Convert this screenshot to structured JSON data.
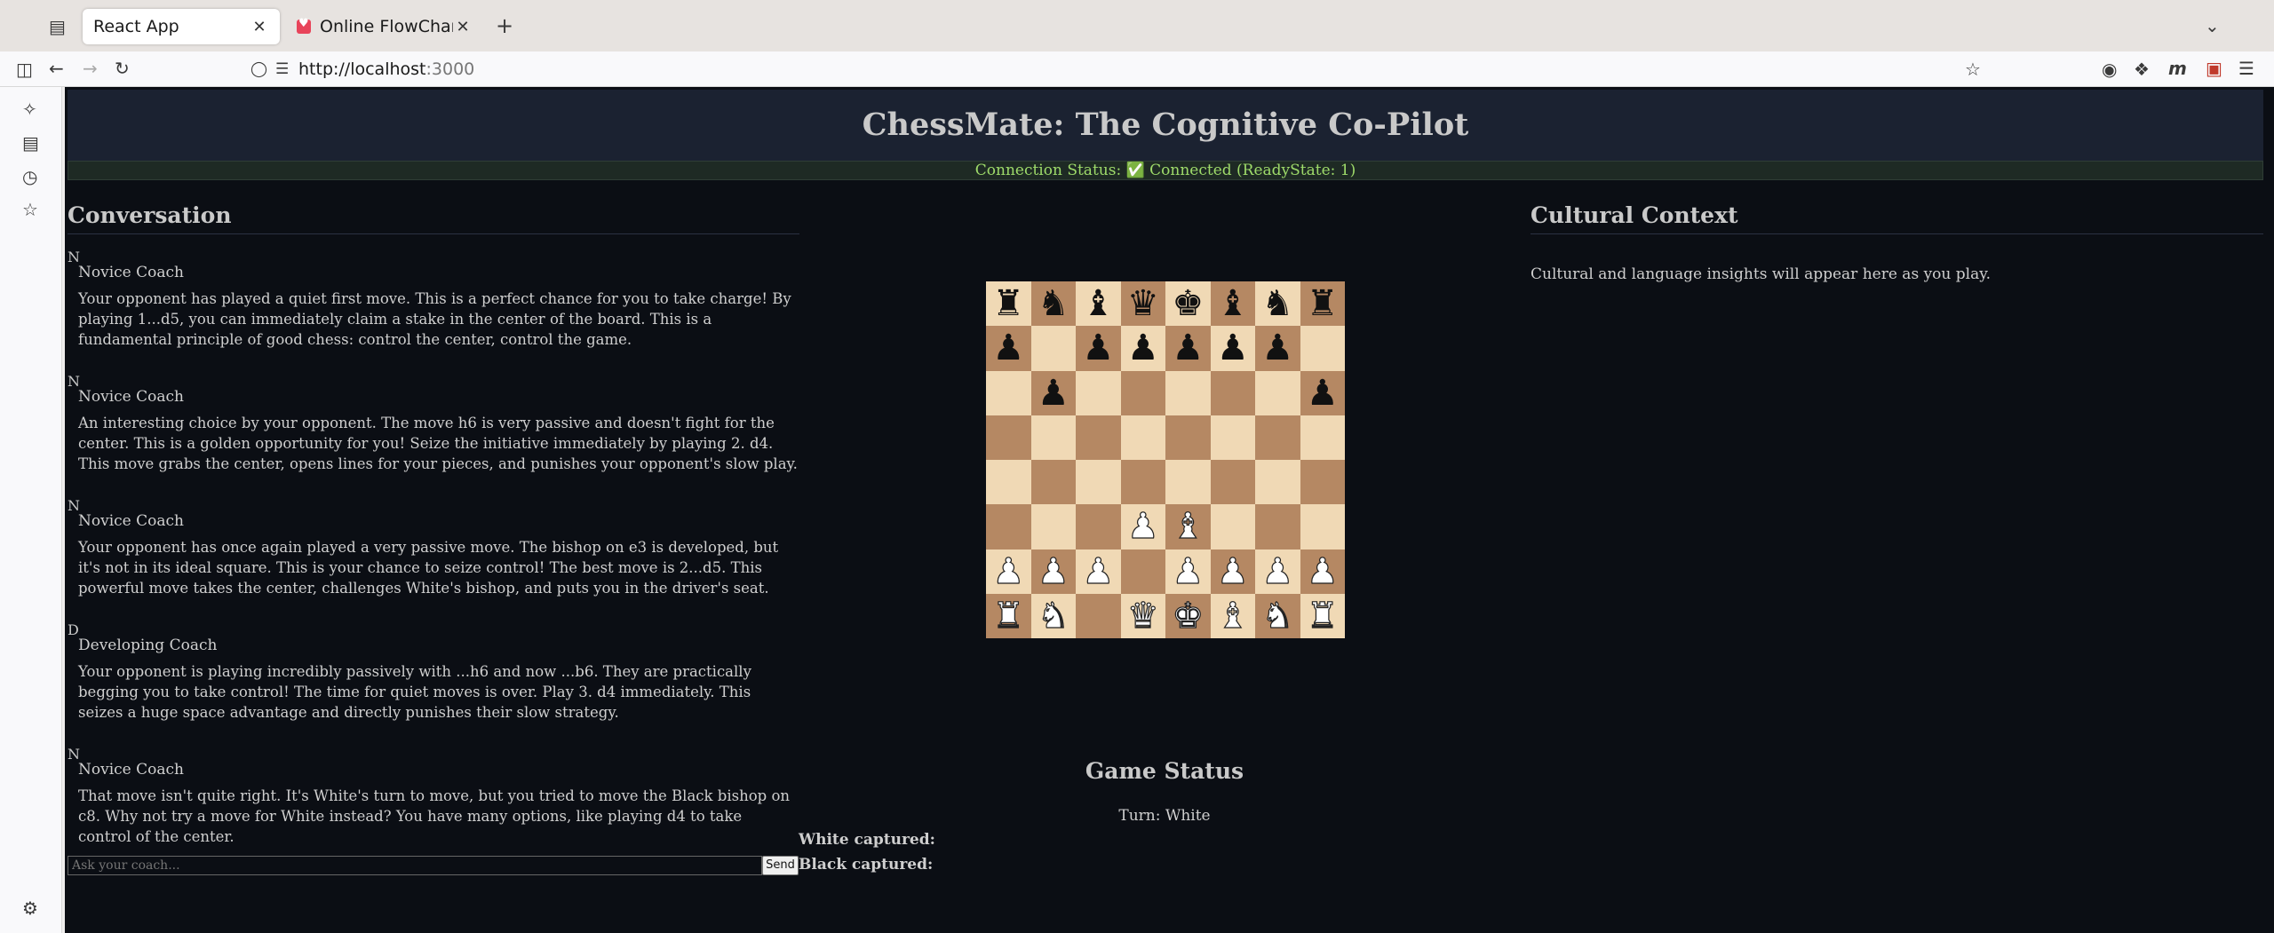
{
  "browser": {
    "tabs": [
      {
        "title": "React App",
        "active": true
      },
      {
        "title": "Online FlowChart & D",
        "active": false
      }
    ],
    "url_host": "http://localhost",
    "url_port": ":3000"
  },
  "app": {
    "title": "ChessMate: The Cognitive Co-Pilot",
    "connection_status": "Connection Status: ✅ Connected (ReadyState: 1)",
    "conversation": {
      "heading": "Conversation",
      "messages": [
        {
          "initial": "N",
          "speaker": "Novice Coach",
          "text": "Your opponent has played a quiet first move. This is a perfect chance for you to take charge! By playing 1...d5, you can immediately claim a stake in the center of the board. This is a fundamental principle of good chess: control the center, control the game."
        },
        {
          "initial": "N",
          "speaker": "Novice Coach",
          "text": "An interesting choice by your opponent. The move h6 is very passive and doesn't fight for the center. This is a golden opportunity for you! Seize the initiative immediately by playing 2. d4. This move grabs the center, opens lines for your pieces, and punishes your opponent's slow play."
        },
        {
          "initial": "N",
          "speaker": "Novice Coach",
          "text": "Your opponent has once again played a very passive move. The bishop on e3 is developed, but it's not in its ideal square. This is your chance to seize control! The best move is 2...d5. This powerful move takes the center, challenges White's bishop, and puts you in the driver's seat."
        },
        {
          "initial": "D",
          "speaker": "Developing Coach",
          "text": "Your opponent is playing incredibly passively with ...h6 and now ...b6. They are practically begging you to take control! The time for quiet moves is over. Play 3. d4 immediately. This seizes a huge space advantage and directly punishes their slow strategy."
        },
        {
          "initial": "N",
          "speaker": "Novice Coach",
          "text": "That move isn't quite right. It's White's turn to move, but you tried to move the Black bishop on c8. Why not try a move for White instead? You have many options, like playing d4 to take control of the center."
        }
      ],
      "input_placeholder": "Ask your coach...",
      "send_label": "Send"
    },
    "board": {
      "ranks": [
        [
          "bR",
          "bN",
          "bB",
          "bQ",
          "bK",
          "bB",
          "bN",
          "bR"
        ],
        [
          "bP",
          "",
          "bP",
          "bP",
          "bP",
          "bP",
          "bP",
          ""
        ],
        [
          "",
          "bP",
          "",
          "",
          "",
          "",
          "",
          "bP"
        ],
        [
          "",
          "",
          "",
          "",
          "",
          "",
          "",
          ""
        ],
        [
          "",
          "",
          "",
          "",
          "",
          "",
          "",
          ""
        ],
        [
          "",
          "",
          "",
          "wP",
          "wB",
          "",
          "",
          ""
        ],
        [
          "wP",
          "wP",
          "wP",
          "",
          "wP",
          "wP",
          "wP",
          "wP"
        ],
        [
          "wR",
          "wN",
          "",
          "wQ",
          "wK",
          "wB",
          "wN",
          "wR"
        ]
      ]
    },
    "game_status": {
      "heading": "Game Status",
      "turn": "Turn: White",
      "white_captured": "White captured:",
      "black_captured": "Black captured:"
    },
    "cultural": {
      "heading": "Cultural Context",
      "text": "Cultural and language insights will appear here as you play."
    }
  }
}
